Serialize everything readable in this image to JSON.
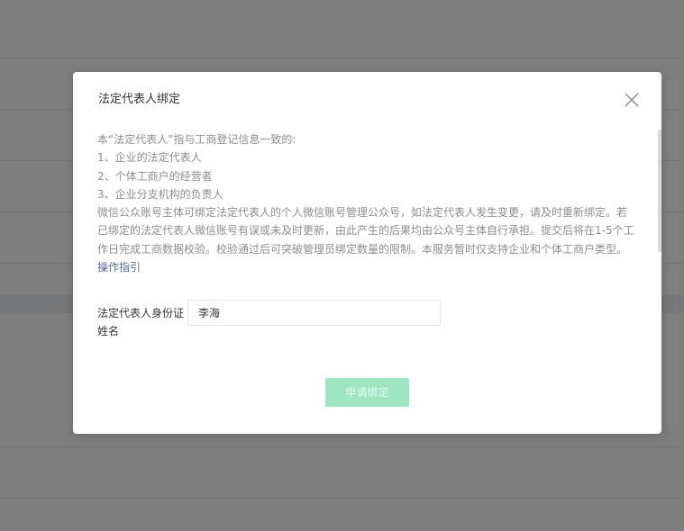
{
  "dialog": {
    "title": "法定代表人绑定",
    "description_lines": [
      "本“法定代表人”指与工商登记信息一致的:",
      "1、企业的法定代表人",
      "2、个体工商户的经营者",
      "3、企业分支机构的负责人"
    ],
    "description_paragraph": "微信公众账号主体可绑定法定代表人的个人微信账号管理公众号，如法定代表人发生变更，请及时重新绑定。若已绑定的法定代表人微信账号有误或未及时更新，由此产生的后果均由公众号主体自行承担。提交后将在1-5个工作日完成工商数据校验。校验通过后可突破管理员绑定数量的限制。本服务暂时仅支持企业和个体工商户类型。",
    "guide_link": "操作指引",
    "form": {
      "name_label": "法定代表人身份证姓名",
      "name_value": "李海"
    },
    "submit_label": "申请绑定"
  },
  "colors": {
    "overlay": "rgba(0,0,0,0.5)",
    "link": "#576b95",
    "submit_disabled_bg": "#9ee6c0",
    "body_text": "#8d8d8d"
  }
}
